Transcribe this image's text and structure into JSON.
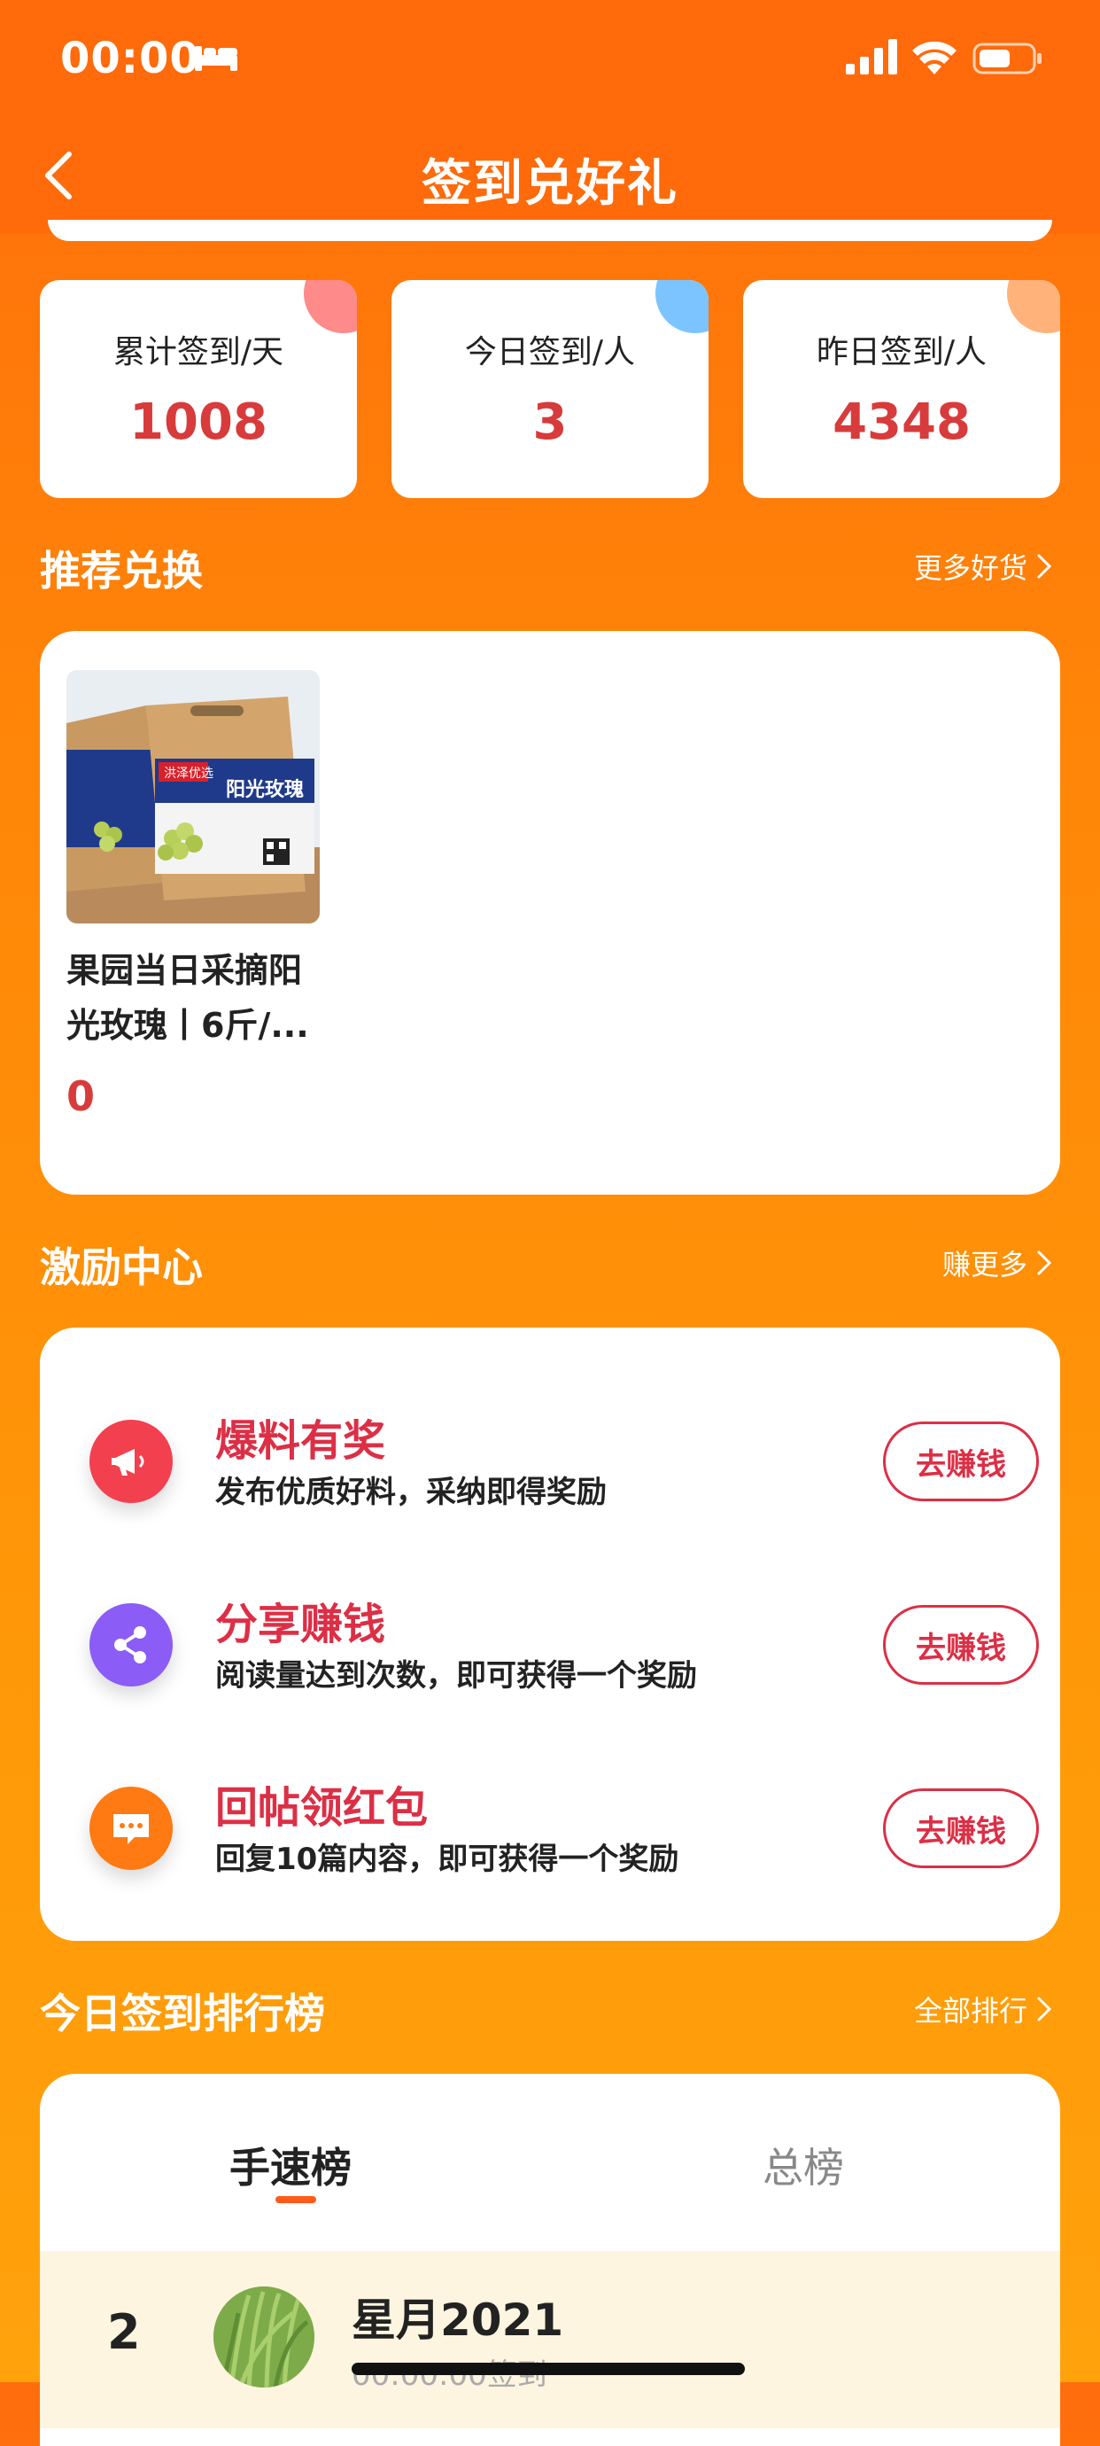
{
  "status": {
    "time": "00:00"
  },
  "nav": {
    "title": "签到兑好礼"
  },
  "stats": [
    {
      "label": "累计签到/天",
      "value": "1008",
      "color": "#ff8a8a"
    },
    {
      "label": "今日签到/人",
      "value": "3",
      "color": "#7cc4ff"
    },
    {
      "label": "昨日签到/人",
      "value": "4348",
      "color": "#ffb27a"
    }
  ],
  "recommend": {
    "title": "推荐兑换",
    "more": "更多好货",
    "product": {
      "name": "果园当日采摘阳光玫瑰丨6斤/...",
      "price": "0",
      "image_icon": "grape-box-image"
    }
  },
  "incentive": {
    "title": "激励中心",
    "more": "赚更多",
    "tasks": [
      {
        "title": "爆料有奖",
        "desc": "发布优质好料，采纳即得奖励",
        "button": "去赚钱",
        "icon": "megaphone-icon",
        "icon_color": "#f2404f"
      },
      {
        "title": "分享赚钱",
        "desc": "阅读量达到次数，即可获得一个奖励",
        "button": "去赚钱",
        "icon": "share-icon",
        "icon_color": "#8b5cf6"
      },
      {
        "title": "回帖领红包",
        "desc": "回复10篇内容，即可获得一个奖励",
        "button": "去赚钱",
        "icon": "chat-icon",
        "icon_color": "#ff7a12"
      }
    ]
  },
  "ranking": {
    "title": "今日签到排行榜",
    "more": "全部排行",
    "tabs": [
      "手速榜",
      "总榜"
    ],
    "rows": [
      {
        "rank": "2",
        "name": "星月2021",
        "sub": "00:00:00签到"
      }
    ]
  }
}
